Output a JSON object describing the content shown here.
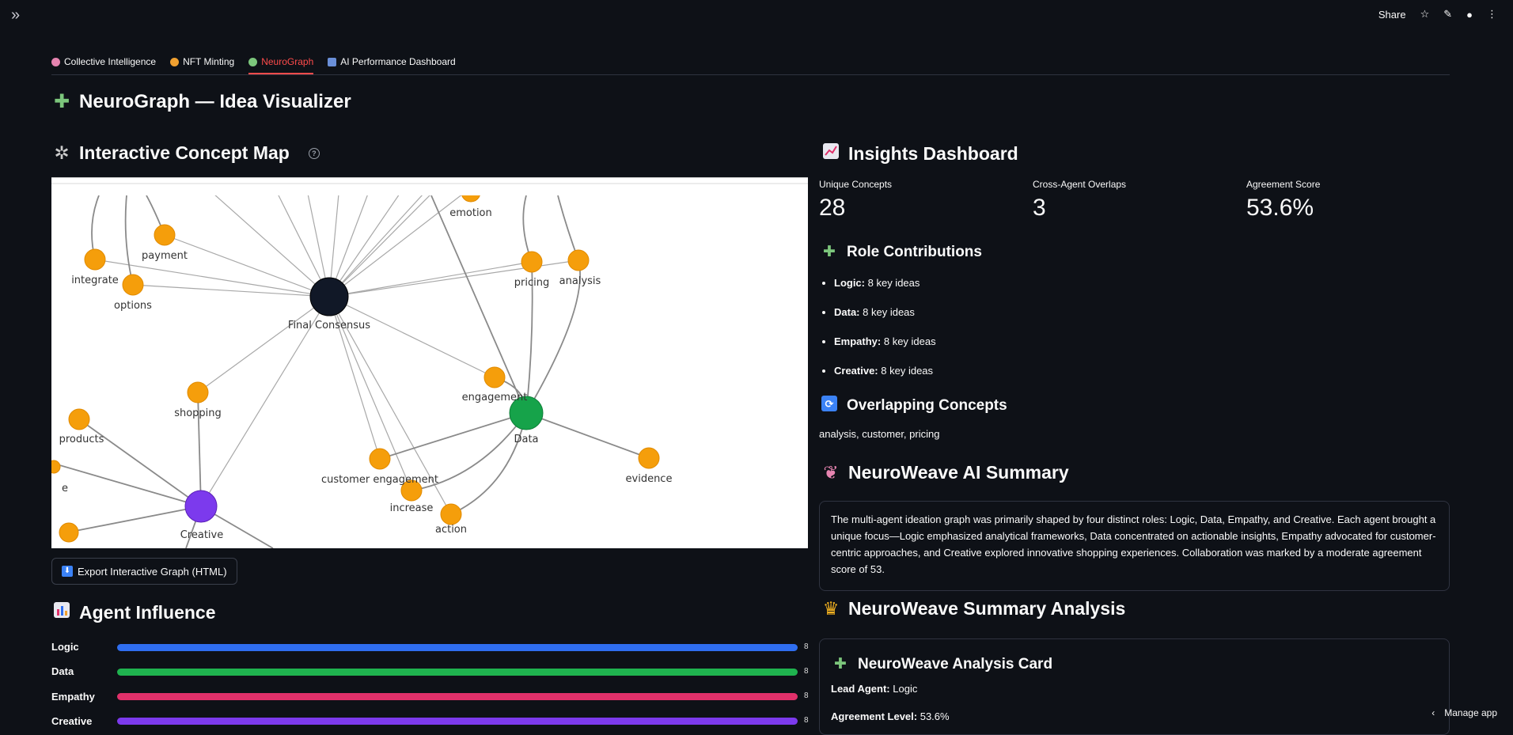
{
  "topbar": {
    "share": "Share",
    "manage_app": "Manage app"
  },
  "tabs": [
    {
      "label": "Collective Intelligence",
      "color": "#e684b0"
    },
    {
      "label": "NFT Minting",
      "color": "#f0a030"
    },
    {
      "label": "NeuroGraph",
      "color": "#7cc67c",
      "active": true
    },
    {
      "label": "AI Performance Dashboard",
      "color": "#6a8fd8"
    }
  ],
  "page": {
    "title": "NeuroGraph — Idea Visualizer"
  },
  "concept_map": {
    "heading": "Interactive Concept Map",
    "export_button": "Export Interactive Graph (HTML)",
    "nodes": {
      "emotion": "emotion",
      "payment": "payment",
      "integrate": "integrate",
      "options": "options",
      "final": "Final Consensus",
      "pricing": "pricing",
      "analysis": "analysis",
      "engagement": "engagement",
      "shopping": "shopping",
      "products": "products",
      "data": "Data",
      "customer_engagement": "customer engagement",
      "increase": "increase",
      "evidence": "evidence",
      "action": "action",
      "creative": "Creative",
      "e_partial": "e"
    }
  },
  "agent_influence": {
    "heading": "Agent Influence",
    "bars": [
      {
        "label": "Logic",
        "value": 8,
        "color": "#2f6ef0"
      },
      {
        "label": "Data",
        "value": 8,
        "color": "#1fb34f"
      },
      {
        "label": "Empathy",
        "value": 8,
        "color": "#e0306a"
      },
      {
        "label": "Creative",
        "value": 8,
        "color": "#7c3aed"
      }
    ]
  },
  "insights": {
    "heading": "Insights Dashboard",
    "metrics": [
      {
        "label": "Unique Concepts",
        "value": "28"
      },
      {
        "label": "Cross-Agent Overlaps",
        "value": "3"
      },
      {
        "label": "Agreement Score",
        "value": "53.6%"
      }
    ]
  },
  "roles": {
    "heading": "Role Contributions",
    "items": [
      {
        "name": "Logic:",
        "text": "8 key ideas"
      },
      {
        "name": "Data:",
        "text": "8 key ideas"
      },
      {
        "name": "Empathy:",
        "text": "8 key ideas"
      },
      {
        "name": "Creative:",
        "text": "8 key ideas"
      }
    ]
  },
  "overlap": {
    "heading": "Overlapping Concepts",
    "text": "analysis, customer, pricing"
  },
  "ai_summary": {
    "heading": "NeuroWeave AI Summary",
    "text": "The multi-agent ideation graph was primarily shaped by four distinct roles: Logic, Data, Empathy, and Creative. Each agent brought a unique focus—Logic emphasized analytical frameworks, Data concentrated on actionable insights, Empathy advocated for customer-centric approaches, and Creative explored innovative shopping experiences. Collaboration was marked by a moderate agreement score of 53."
  },
  "summary_analysis": {
    "heading": "NeuroWeave Summary Analysis",
    "card_title": "NeuroWeave Analysis Card",
    "lead_label": "Lead Agent:",
    "lead_value": "Logic",
    "agreement_label": "Agreement Level:",
    "agreement_value": "53.6%"
  }
}
